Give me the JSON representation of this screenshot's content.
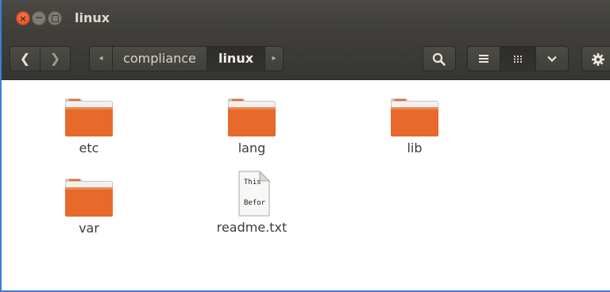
{
  "window": {
    "title": "linux",
    "accent_color": "#3c7fd6"
  },
  "titlebar": {
    "close_glyph": "×",
    "minimize_glyph": "−"
  },
  "toolbar": {
    "back_glyph": "❮",
    "forward_glyph": "❯",
    "path_scroll_left_glyph": "◂",
    "path_scroll_right_glyph": "▸",
    "breadcrumbs": [
      {
        "label": "compliance",
        "active": false
      },
      {
        "label": "linux",
        "active": true
      }
    ],
    "icons": [
      "back-icon",
      "forward-icon",
      "search-icon",
      "list-view-icon",
      "grid-view-icon",
      "chevron-down-icon",
      "gear-icon"
    ]
  },
  "files": [
    {
      "name": "etc",
      "type": "folder"
    },
    {
      "name": "lang",
      "type": "folder"
    },
    {
      "name": "lib",
      "type": "folder"
    },
    {
      "name": "var",
      "type": "folder"
    },
    {
      "name": "readme.txt",
      "type": "text",
      "preview_lines": [
        "This",
        "Befor"
      ]
    }
  ],
  "colors": {
    "folder_orange": "#e8692c",
    "titlebar_bg": "#3d3c38"
  }
}
